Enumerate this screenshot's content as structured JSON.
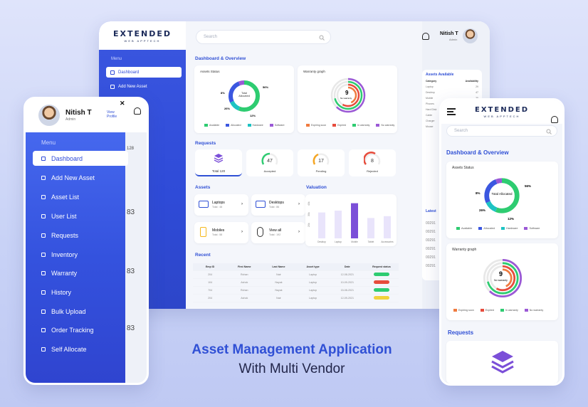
{
  "brand": {
    "logo_main": "EXTENDED",
    "logo_sub": "WEB APPTECH"
  },
  "headline": {
    "line1": "Asset Management Application",
    "line2": "With Multi Vendor"
  },
  "desktop": {
    "menu_title": "Menu",
    "nav": [
      {
        "label": "Dashboard"
      },
      {
        "label": "Add New Asset"
      }
    ],
    "search_placeholder": "Search",
    "user": {
      "name": "Nitish T",
      "role": "Admin"
    },
    "dashboard_title": "Dashboard & Overview",
    "asset_status": {
      "title": "Assets Status",
      "center": "Total Allocated",
      "slices": [
        {
          "label": "Available",
          "value": 56,
          "color": "#2ecc71"
        },
        {
          "label": "Allocated",
          "value": 26,
          "color": "#3b57e0"
        },
        {
          "label": "Hardware",
          "value": 12,
          "color": "#1dc3c3"
        },
        {
          "label": "Software",
          "value": 8,
          "color": "#9b59d6"
        }
      ],
      "pct": [
        "56%",
        "26%",
        "12%",
        "8%"
      ]
    },
    "warranty": {
      "title": "Warranty graph",
      "value": "9",
      "center_label": "No warranty",
      "legend": [
        "Expiring soon",
        "Expired",
        "In warranty",
        "No warranty"
      ],
      "colors": [
        "#f07b3f",
        "#e74c3c",
        "#2ecc71",
        "#9b59d6"
      ]
    },
    "requests_title": "Requests",
    "requests": [
      {
        "label": "Total 120",
        "value": ""
      },
      {
        "label": "Accepted",
        "value": "47"
      },
      {
        "label": "Pending",
        "value": "17"
      },
      {
        "label": "Rejected",
        "value": "8"
      }
    ],
    "assets_title": "Assets",
    "assets": [
      {
        "name": "Laptops",
        "sub": "Total : 48"
      },
      {
        "name": "Desktops",
        "sub": "Total : 86"
      },
      {
        "name": "Mobiles",
        "sub": "Total : 58"
      },
      {
        "name": "View all",
        "sub": "Total : 192"
      }
    ],
    "valuation_title": "Valuation",
    "valuation": {
      "categories": [
        "Desktop",
        "Laptop",
        "Mobile",
        "Tablet",
        "Accessories"
      ],
      "values": [
        28,
        30,
        38,
        22,
        24
      ],
      "ylabels": [
        "40k",
        "30k",
        "20k"
      ]
    },
    "recent_title": "Recent",
    "table": {
      "headers": [
        "Emp ID",
        "First Name",
        "Last Name",
        "Asset type",
        "Date",
        "Request status"
      ],
      "rows": [
        [
          "204",
          "Rohan",
          "Nair",
          "Laptop",
          "12-08-2021",
          "Approved"
        ],
        [
          "104",
          "Ashok",
          "Nayak",
          "Laptop",
          "10-09-2021",
          "Rejected"
        ],
        [
          "704",
          "Rohan",
          "Nayak",
          "Laptop",
          "15-08-2021",
          "Approved"
        ],
        [
          "204",
          "Ashok",
          "Nair",
          "Laptop",
          "12-09-2021",
          "Pending"
        ]
      ],
      "status_colors": {
        "Approved": "#2ecc71",
        "Rejected": "#e74c3c",
        "Pending": "#f1d33d"
      }
    },
    "available_title": "Assets Available",
    "available_headers": [
      "Category",
      "Availability"
    ],
    "available": [
      [
        "Laptop",
        "29"
      ],
      [
        "Desktop",
        "47"
      ],
      [
        "Mobile",
        "35"
      ],
      [
        "Phones",
        "10"
      ],
      [
        "Hard Disk",
        "15"
      ],
      [
        "Cable",
        "26"
      ],
      [
        "Charger",
        "12"
      ],
      [
        "Mouse",
        "21"
      ]
    ],
    "latest_title": "Latest",
    "latest_ids": [
      "00291",
      "00291",
      "00291",
      "00291",
      "00291",
      "00291"
    ]
  },
  "phone_left": {
    "user": {
      "name": "Nitish T",
      "role": "Admin",
      "link": "View Profile"
    },
    "menu_title": "Menu",
    "nav": [
      {
        "label": "Dashboard",
        "icon": "grid-icon"
      },
      {
        "label": "Add New Asset",
        "icon": "plus-square-icon"
      },
      {
        "label": "Asset List",
        "icon": "list-icon"
      },
      {
        "label": "User List",
        "icon": "users-icon"
      },
      {
        "label": "Requests",
        "icon": "edit-icon"
      },
      {
        "label": "Inventory",
        "icon": "box-icon"
      },
      {
        "label": "Warranty",
        "icon": "shield-icon"
      },
      {
        "label": "History",
        "icon": "file-icon"
      },
      {
        "label": "Bulk Upload",
        "icon": "upload-icon"
      },
      {
        "label": "Order Tracking",
        "icon": "tracking-icon"
      },
      {
        "label": "Self Allocate",
        "icon": "allocate-icon"
      }
    ],
    "right_values": [
      "128",
      "128",
      "83",
      "83",
      "83"
    ]
  },
  "phone_right": {
    "search_placeholder": "Search",
    "dashboard_title": "Dashboard & Overview",
    "asset_status_title": "Assets Status",
    "asset_center": "Total Allocated",
    "asset_pct": [
      "56%",
      "26%",
      "12%",
      "8%"
    ],
    "asset_legend": [
      "Available",
      "Allocated",
      "Hardware",
      "Software"
    ],
    "warranty_title": "Warranty graph",
    "warranty_value": "9",
    "warranty_center": "No warranty",
    "warranty_legend": [
      "Expiring soon",
      "Expired",
      "In warranty",
      "No warranty"
    ],
    "requests_title": "Requests"
  }
}
